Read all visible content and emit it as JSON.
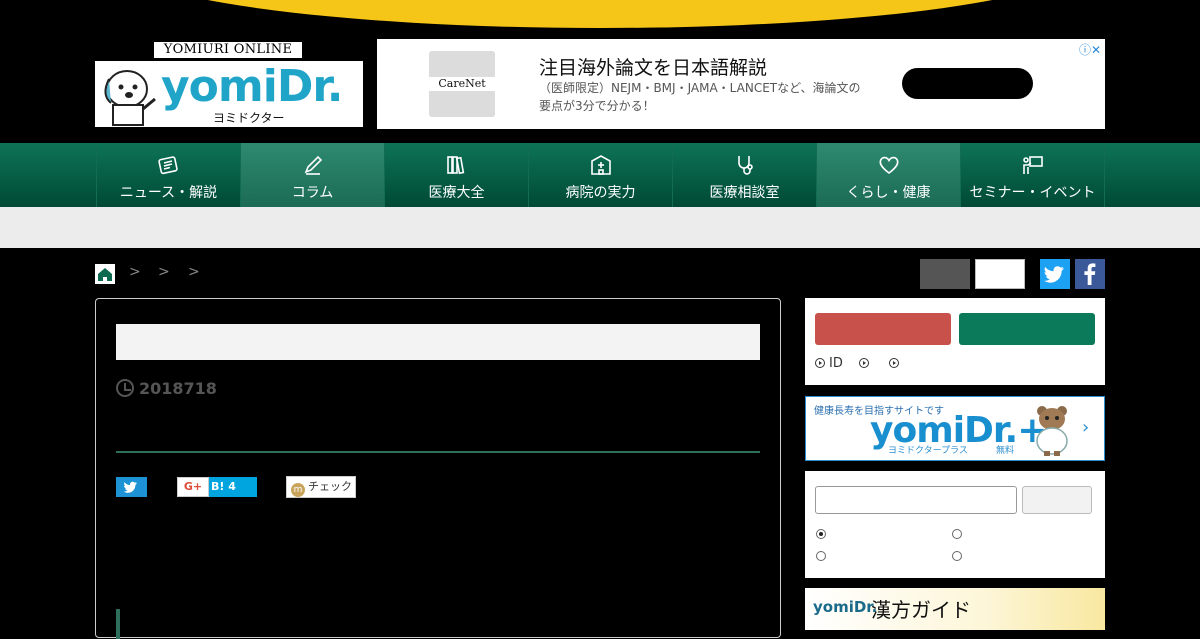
{
  "header": {
    "logo_online": "YOMIURI ONLINE",
    "logo_brand": "yomiDr.",
    "logo_kana": "ヨミドクター"
  },
  "ad": {
    "thumb_label": "CareNet",
    "headline": "注目海外論文を日本語解説",
    "description": "（医師限定）NEJM・BMJ・JAMA・LANCETなど、海論文の要点が3分で分かる！",
    "info_icon": "ⓘ✕"
  },
  "nav": {
    "items": [
      {
        "label": "ニュース・解説",
        "icon": "newspaper-icon"
      },
      {
        "label": "コラム",
        "icon": "pencil-icon"
      },
      {
        "label": "医療大全",
        "icon": "books-icon"
      },
      {
        "label": "病院の実力",
        "icon": "hospital-icon"
      },
      {
        "label": "医療相談室",
        "icon": "stethoscope-icon"
      },
      {
        "label": "くらし・健康",
        "icon": "heart-icon"
      },
      {
        "label": "セミナー・イベント",
        "icon": "presenter-icon"
      }
    ]
  },
  "breadcrumb": {
    "separators": [
      ">",
      ">",
      ">"
    ]
  },
  "article": {
    "date": "2018718"
  },
  "share": {
    "google_plus": "G+",
    "hatena": "B! 4",
    "mixi_check": "チェック"
  },
  "sidebar": {
    "login_links": [
      "ID",
      "",
      ""
    ],
    "plus_banner": {
      "tagline": "健康長寿を目指すサイトです",
      "brand": "yomiDr.+",
      "sub": "ヨミドクタープラス",
      "free": "無料",
      "chevron": "›"
    },
    "kampo_banner": {
      "brand": "yomiDr.",
      "title": "漢方ガイド"
    }
  },
  "colors": {
    "accent_green": "#0b7a5a",
    "nav_green": "#004a35",
    "login_red": "#c9514c",
    "twitter": "#1da1f2",
    "facebook": "#3b5998",
    "top_yellow": "#f5c518"
  }
}
